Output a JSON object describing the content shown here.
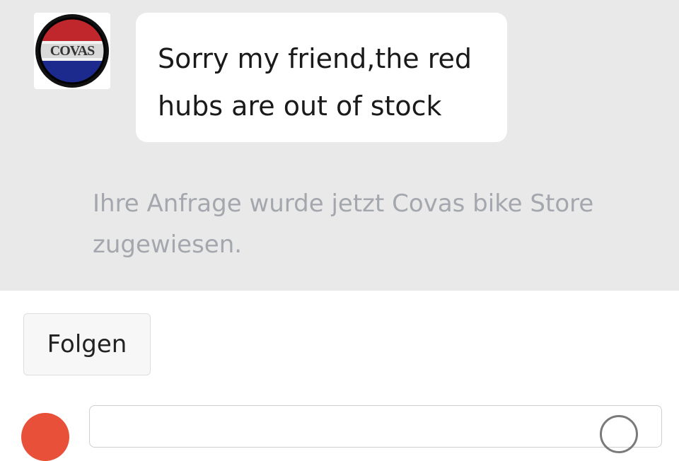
{
  "conversation": {
    "message": {
      "sender_avatar": {
        "icon": "covas-logo-icon",
        "colors": [
          "#c0272d",
          "#ffffff",
          "#1b2a8c"
        ]
      },
      "text": "Sorry my friend,the red hubs are out of stock"
    },
    "system_note": "Ihre Anfrage wurde jetzt Covas bike Store zugewiesen."
  },
  "actions": {
    "follow_label": "Folgen"
  },
  "composer": {
    "placeholder": "",
    "avatar_color": "#e8503a"
  }
}
